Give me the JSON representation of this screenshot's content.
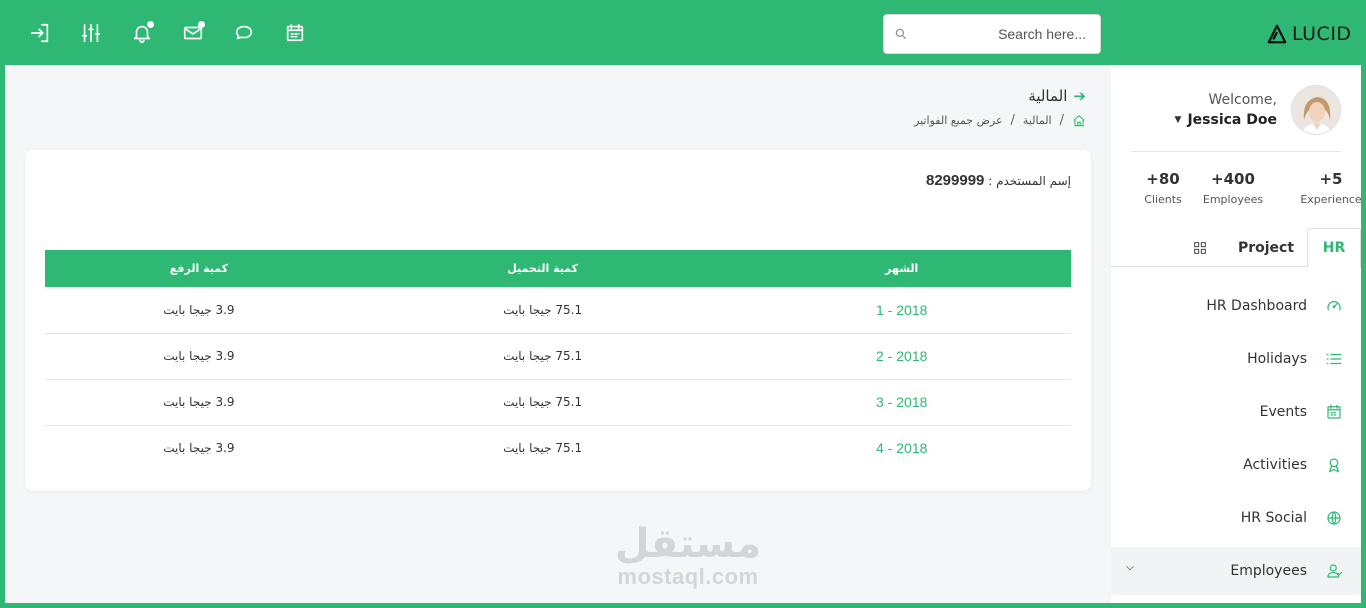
{
  "topbar": {
    "icons": [
      "logout-icon",
      "sliders-icon",
      "bell-icon",
      "mail-icon",
      "chat-icon",
      "calendar-icon"
    ],
    "search_placeholder": "Search here...",
    "brand": "LUCID",
    "brand_color": "#2fb873"
  },
  "page": {
    "title": "المالية",
    "breadcrumb": [
      "المالية",
      "عرض جميع الفواتير"
    ]
  },
  "card": {
    "user_label": "إسم المستخدم :",
    "user_value": "8299999",
    "columns": [
      "الشهر",
      "كمية التحميل",
      "كمية الرفع"
    ],
    "rows": [
      {
        "month": "2018 - 1",
        "download": "75.1 جيجا بايت",
        "upload": "3.9 جيجا بايت"
      },
      {
        "month": "2018 - 2",
        "download": "75.1 جيجا بايت",
        "upload": "3.9 جيجا بايت"
      },
      {
        "month": "2018 - 3",
        "download": "75.1 جيجا بايت",
        "upload": "3.9 جيجا بايت"
      },
      {
        "month": "2018 - 4",
        "download": "75.1 جيجا بايت",
        "upload": "3.9 جيجا بايت"
      }
    ]
  },
  "watermark": {
    "arabic": "مستقل",
    "latin": "mostaql.com"
  },
  "sidebar": {
    "welcome": "Welcome,",
    "user_name": "Jessica Doe",
    "stats": [
      {
        "value": "+5",
        "label": "Experience"
      },
      {
        "value": "+400",
        "label": "Employees"
      },
      {
        "value": "+80",
        "label": "Clients"
      }
    ],
    "tabs": {
      "hr": "HR",
      "project": "Project"
    },
    "menu": [
      {
        "label": "HR Dashboard",
        "icon": "speedometer-icon"
      },
      {
        "label": "Holidays",
        "icon": "list-icon"
      },
      {
        "label": "Events",
        "icon": "calendar-icon"
      },
      {
        "label": "Activities",
        "icon": "badge-icon"
      },
      {
        "label": "HR Social",
        "icon": "globe-icon"
      },
      {
        "label": "Employees",
        "icon": "users-icon"
      }
    ]
  }
}
